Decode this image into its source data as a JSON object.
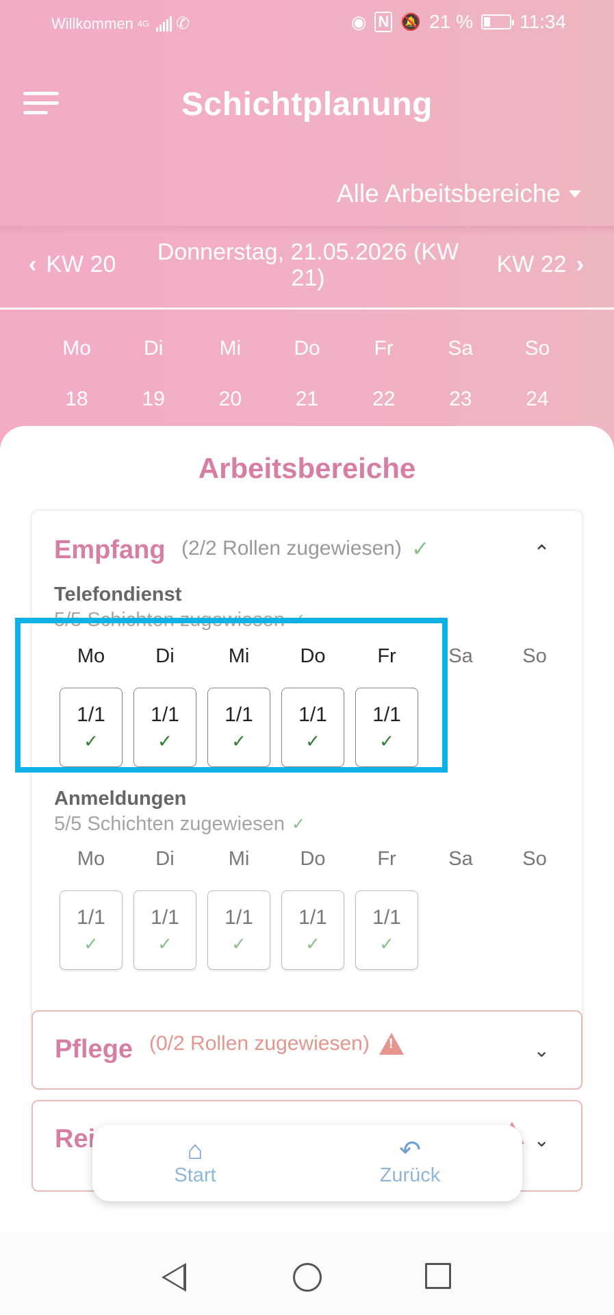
{
  "status_bar": {
    "carrier": "Willkommen",
    "network": "4G",
    "battery_percent": "21 %",
    "battery_level": 0.21,
    "time": "11:34"
  },
  "app": {
    "title": "Schichtplanung",
    "area_selector": "Alle Arbeitsbereiche"
  },
  "week_nav": {
    "prev": "KW 20",
    "current": "Donnerstag, 21.05.2026 (KW 21)",
    "next": "KW 22"
  },
  "week_days": {
    "names": [
      "Mo",
      "Di",
      "Mi",
      "Do",
      "Fr",
      "Sa",
      "So"
    ],
    "numbers": [
      "18",
      "19",
      "20",
      "21",
      "22",
      "23",
      "24"
    ]
  },
  "sheet": {
    "title": "Arbeitsbereiche"
  },
  "areas": [
    {
      "name": "Empfang",
      "summary": "(2/2 Rollen zugewiesen)",
      "roles": [
        {
          "name": "Telefondienst",
          "count": "5/5 Schichten zugewiesen",
          "days": [
            "Mo",
            "Di",
            "Mi",
            "Do",
            "Fr",
            "Sa",
            "So"
          ],
          "shifts": [
            "1/1",
            "1/1",
            "1/1",
            "1/1",
            "1/1"
          ]
        },
        {
          "name": "Anmeldungen",
          "count": "5/5 Schichten zugewiesen",
          "days": [
            "Mo",
            "Di",
            "Mi",
            "Do",
            "Fr",
            "Sa",
            "So"
          ],
          "shifts": [
            "1/1",
            "1/1",
            "1/1",
            "1/1",
            "1/1"
          ]
        }
      ]
    },
    {
      "name": "Pflege",
      "summary": "(0/2 Rollen zugewiesen)"
    },
    {
      "name": "Rei"
    }
  ],
  "bottom_nav": {
    "start": "Start",
    "back": "Zurück"
  },
  "colors": {
    "header_pink": "#f3abc5",
    "accent_pink": "#d77ea6",
    "highlight_blue": "#0fb0e6",
    "success_green": "#2e7d32",
    "warning_red": "#e6968f"
  }
}
